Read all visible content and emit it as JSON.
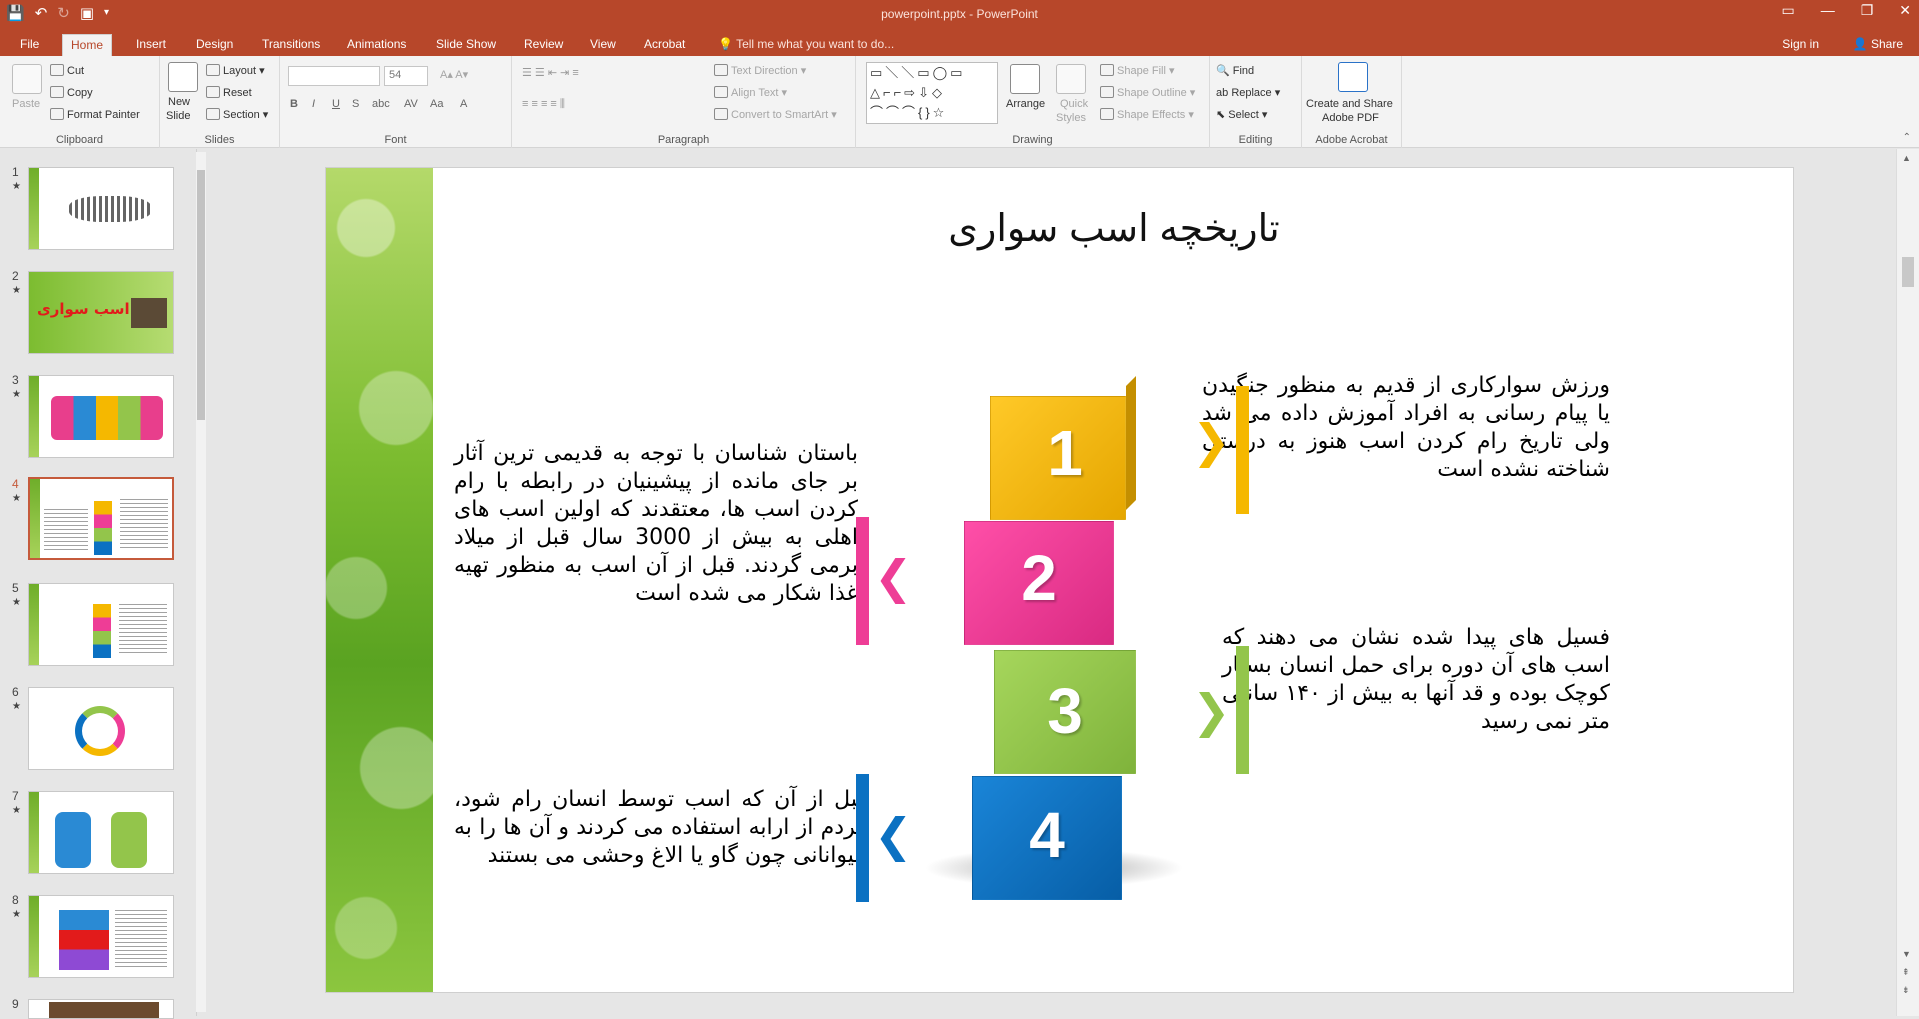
{
  "window": {
    "title": "powerpoint.pptx - PowerPoint",
    "controls": [
      "▭",
      "—",
      "❐",
      "✕"
    ]
  },
  "tabs": [
    {
      "label": "File"
    },
    {
      "label": "Home"
    },
    {
      "label": "Insert"
    },
    {
      "label": "Design"
    },
    {
      "label": "Transitions"
    },
    {
      "label": "Animations"
    },
    {
      "label": "Slide Show"
    },
    {
      "label": "Review"
    },
    {
      "label": "View"
    },
    {
      "label": "Acrobat"
    }
  ],
  "tellme": "Tell me what you want to do...",
  "signin": "Sign in",
  "share": "Share",
  "ribbon": {
    "clipboard": {
      "label": "Clipboard",
      "paste": "Paste",
      "cut": "Cut",
      "copy": "Copy",
      "format_painter": "Format Painter"
    },
    "slides": {
      "label": "Slides",
      "new_slide": "New",
      "new_slide2": "Slide",
      "layout": "Layout",
      "reset": "Reset",
      "section": "Section"
    },
    "font": {
      "label": "Font",
      "size": "54"
    },
    "paragraph": {
      "label": "Paragraph",
      "text_direction": "Text Direction",
      "align_text": "Align Text",
      "smartart": "Convert to SmartArt"
    },
    "drawing": {
      "label": "Drawing",
      "arrange": "Arrange",
      "quick_styles": "Quick",
      "quick_styles2": "Styles",
      "shape_fill": "Shape Fill",
      "shape_outline": "Shape Outline",
      "shape_effects": "Shape Effects"
    },
    "editing": {
      "label": "Editing",
      "find": "Find",
      "replace": "Replace",
      "select": "Select"
    },
    "acrobat": {
      "label": "Adobe Acrobat",
      "create": "Create and Share",
      "create2": "Adobe PDF"
    }
  },
  "thumbnails": [
    {
      "num": "1"
    },
    {
      "num": "2",
      "title": "اسب سواری"
    },
    {
      "num": "3"
    },
    {
      "num": "4"
    },
    {
      "num": "5"
    },
    {
      "num": "6"
    },
    {
      "num": "7"
    },
    {
      "num": "8"
    },
    {
      "num": "9"
    }
  ],
  "slide": {
    "title": "تاریخچه اسب سواری",
    "text1": "ورزش سوارکاری از قدیم به منظور جنگیدن یا پیام رسانی به افراد آموزش داده می شد ولی تاریخ رام کردن اسب هنوز به درستی شناخته نشده است",
    "text2": "باستان شناسان با توجه به قدیمی ترین آثار بر جای مانده از پیشینیان در رابطه با رام کردن اسب ها، معتقدند که اولین اسب های اهلی به بیش از 3000 سال قبل از میلاد برمی گردند. قبل از آن اسب به منظور تهیه غذا شکار می شده است",
    "text3": "فسیل های پیدا شده نشان می دهند که اسب های آن دوره برای حمل انسان بسیار کوچک بوده و قد آنها به بیش از ۱۴۰ سانتی متر نمی رسید",
    "text4": "قبل از آن که اسب توسط انسان رام شود، مردم از ارابه استفاده می کردند و آن ها را به حیوانانی چون گاو یا الاغ وحشی می بستند",
    "cubes": [
      "1",
      "2",
      "3",
      "4"
    ],
    "colors": {
      "yellow": "#f5b800",
      "pink": "#ee3d96",
      "green": "#93c54b",
      "blue": "#0b71c2"
    }
  }
}
